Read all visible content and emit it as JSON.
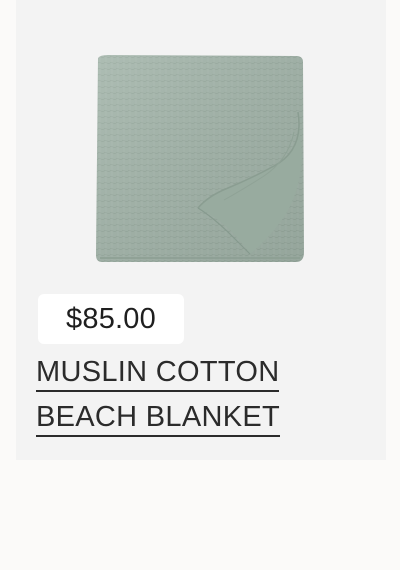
{
  "product": {
    "price": "$85.00",
    "title_line_1": "MUSLIN COTTON",
    "title_line_2": "BEACH BLANKET",
    "image_icon": "folded-blanket-image",
    "colors": {
      "card_background": "#f3f3f3",
      "blanket": "#9fb1a6",
      "text": "#2b2b2b"
    }
  }
}
